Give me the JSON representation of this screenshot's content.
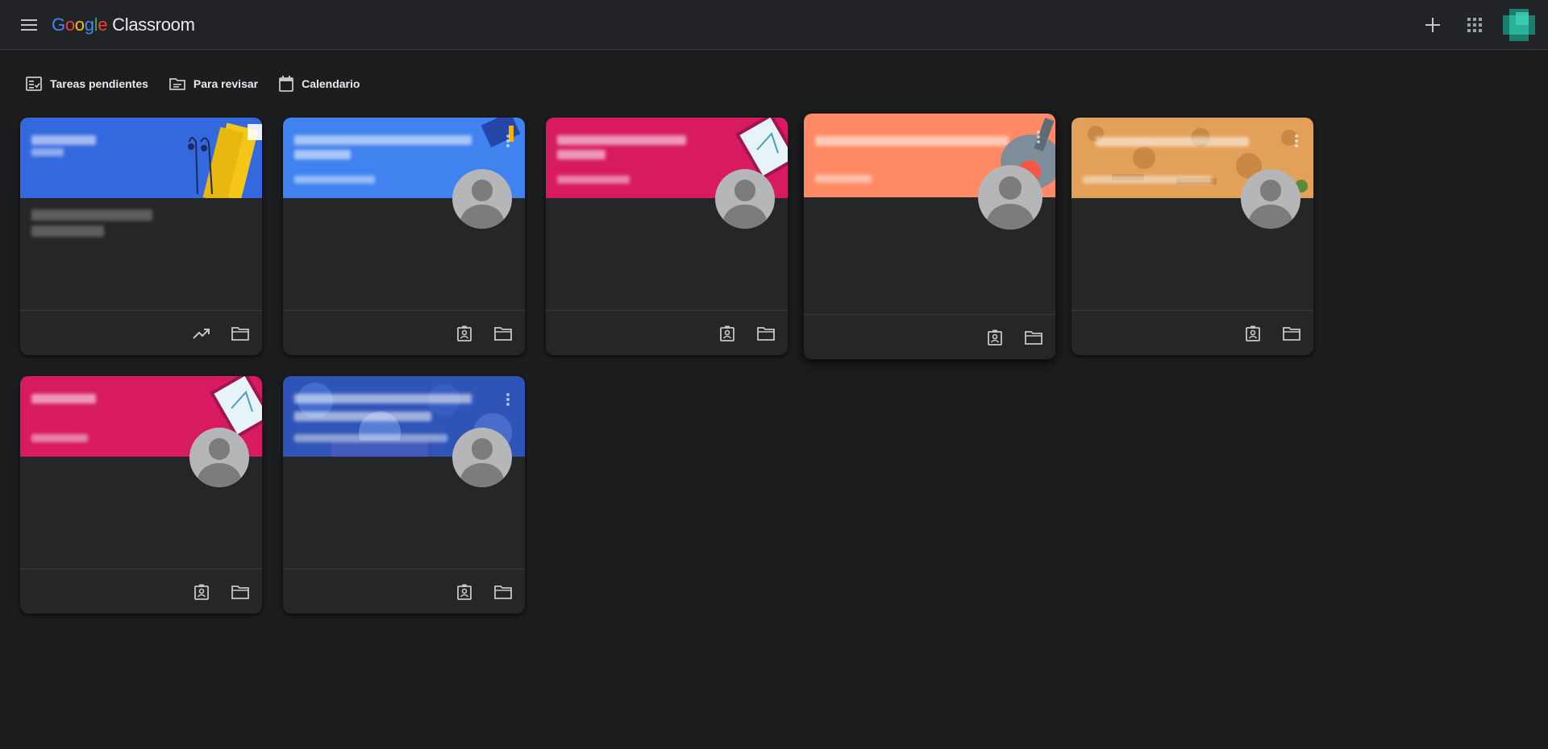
{
  "header": {
    "menu_icon": "hamburger-menu-icon",
    "logo_letters": [
      "G",
      "o",
      "o",
      "g",
      "l",
      "e"
    ],
    "logo_colors": [
      "#4285f4",
      "#ea4335",
      "#fbbc05",
      "#4285f4",
      "#34a853",
      "#ea4335"
    ],
    "app_name": "Classroom",
    "add_icon": "plus-icon",
    "apps_icon": "apps-grid-icon",
    "account_icon": "account-avatar-icon"
  },
  "toolbar": {
    "items": [
      {
        "label": "Tareas pendientes",
        "icon": "checklist-icon"
      },
      {
        "label": "Para revisar",
        "icon": "review-folder-icon"
      },
      {
        "label": "Calendario",
        "icon": "calendar-icon"
      }
    ]
  },
  "cards": [
    {
      "banner_color": "#3468de",
      "theme": "headphones-notebook",
      "has_avatar": false,
      "footer_icons": [
        "trending-up-icon",
        "folder-icon"
      ]
    },
    {
      "banner_color": "#3f82f0",
      "theme": "books",
      "has_avatar": true,
      "footer_icons": [
        "assignment-ind-icon",
        "folder-icon"
      ]
    },
    {
      "banner_color": "#d81b60",
      "theme": "math-tablet",
      "has_avatar": true,
      "footer_icons": [
        "assignment-ind-icon",
        "folder-icon"
      ]
    },
    {
      "banner_color": "#ff8a65",
      "theme": "guitar",
      "has_avatar": true,
      "footer_icons": [
        "assignment-ind-icon",
        "folder-icon"
      ]
    },
    {
      "banner_color": "#e3a058",
      "theme": "craft",
      "has_avatar": true,
      "footer_icons": [
        "assignment-ind-icon",
        "folder-icon"
      ]
    },
    {
      "banner_color": "#d81b60",
      "theme": "math-tablet",
      "has_avatar": true,
      "footer_icons": [
        "assignment-ind-icon",
        "folder-icon"
      ]
    },
    {
      "banner_color": "#2f54b8",
      "theme": "photo",
      "has_avatar": true,
      "footer_icons": [
        "assignment-ind-icon",
        "folder-icon"
      ]
    }
  ]
}
